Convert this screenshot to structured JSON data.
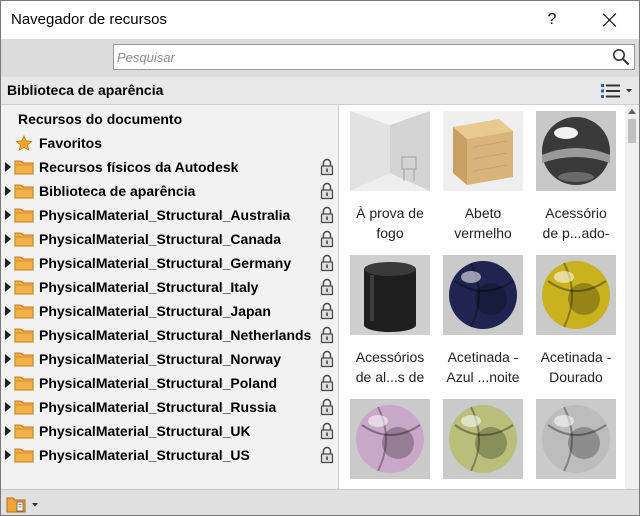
{
  "window": {
    "title": "Navegador de recursos",
    "help_label": "?"
  },
  "search": {
    "placeholder": "Pesquisar",
    "value": ""
  },
  "library_header": {
    "title": "Biblioteca de aparência"
  },
  "tree": {
    "items": [
      {
        "label": "Recursos do documento",
        "icon": "none",
        "expandable": false,
        "locked": false
      },
      {
        "label": "Favoritos",
        "icon": "star-icon",
        "expandable": false,
        "locked": false
      },
      {
        "label": "Recursos físicos da Autodesk",
        "icon": "folder-icon",
        "expandable": true,
        "locked": true
      },
      {
        "label": "Biblioteca de aparência",
        "icon": "folder-icon",
        "expandable": true,
        "locked": true
      },
      {
        "label": "PhysicalMaterial_Structural_Australia",
        "icon": "folder-icon",
        "expandable": true,
        "locked": true
      },
      {
        "label": "PhysicalMaterial_Structural_Canada",
        "icon": "folder-icon",
        "expandable": true,
        "locked": true
      },
      {
        "label": "PhysicalMaterial_Structural_Germany",
        "icon": "folder-icon",
        "expandable": true,
        "locked": true
      },
      {
        "label": "PhysicalMaterial_Structural_Italy",
        "icon": "folder-icon",
        "expandable": true,
        "locked": true
      },
      {
        "label": "PhysicalMaterial_Structural_Japan",
        "icon": "folder-icon",
        "expandable": true,
        "locked": true
      },
      {
        "label": "PhysicalMaterial_Structural_Netherlands",
        "icon": "folder-icon",
        "expandable": true,
        "locked": true
      },
      {
        "label": "PhysicalMaterial_Structural_Norway",
        "icon": "folder-icon",
        "expandable": true,
        "locked": true
      },
      {
        "label": "PhysicalMaterial_Structural_Poland",
        "icon": "folder-icon",
        "expandable": true,
        "locked": true
      },
      {
        "label": "PhysicalMaterial_Structural_Russia",
        "icon": "folder-icon",
        "expandable": true,
        "locked": true
      },
      {
        "label": "PhysicalMaterial_Structural_UK",
        "icon": "folder-icon",
        "expandable": true,
        "locked": true
      },
      {
        "label": "PhysicalMaterial_Structural_US",
        "icon": "folder-icon",
        "expandable": true,
        "locked": true
      }
    ]
  },
  "materials": [
    {
      "line1": "À prova de",
      "line2": "fogo",
      "swatch": "fireproof-room",
      "color": "#e6e6e6"
    },
    {
      "line1": "Abeto",
      "line2": "vermelho",
      "swatch": "wood-cube",
      "color": "#d9b47a"
    },
    {
      "line1": "Acessório",
      "line2": "de p...ado-",
      "swatch": "chrome-sphere",
      "color": "#3a3a3a"
    },
    {
      "line1": "Acessórios",
      "line2": "de al...s de",
      "swatch": "black-cylinder",
      "color": "#1e1e1e"
    },
    {
      "line1": "Acetinada -",
      "line2": "Azul ...noite",
      "swatch": "navy-sphere",
      "color": "#1f2450"
    },
    {
      "line1": "Acetinada -",
      "line2": "Dourado",
      "swatch": "gold-sphere",
      "color": "#c9b21e"
    },
    {
      "line1": "",
      "line2": "",
      "swatch": "pink-sphere",
      "color": "#c9a7c9"
    },
    {
      "line1": "",
      "line2": "",
      "swatch": "olive-sphere",
      "color": "#b9be7a"
    },
    {
      "line1": "",
      "line2": "",
      "swatch": "silver-sphere",
      "color": "#bcbcbc"
    }
  ]
}
